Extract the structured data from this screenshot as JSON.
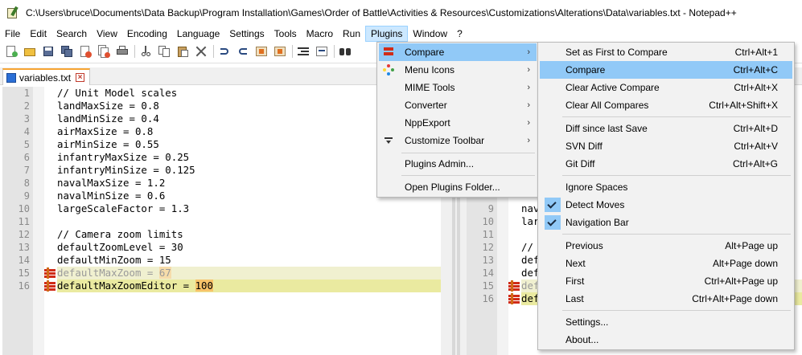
{
  "window": {
    "title": "C:\\Users\\bruce\\Documents\\Data Backup\\Program Installation\\Games\\Order of Battle\\Activities & Resources\\Customizations\\Alterations\\Data\\variables.txt - Notepad++"
  },
  "menubar": {
    "items": [
      "File",
      "Edit",
      "Search",
      "View",
      "Encoding",
      "Language",
      "Settings",
      "Tools",
      "Macro",
      "Run",
      "Plugins",
      "Window",
      "?"
    ]
  },
  "tab": {
    "label": "variables.txt"
  },
  "editor_left": {
    "lines": [
      {
        "n": "1",
        "text": "// Unit Model scales"
      },
      {
        "n": "2",
        "text": "landMaxSize = 0.8"
      },
      {
        "n": "3",
        "text": "landMinSize = 0.4"
      },
      {
        "n": "4",
        "text": "airMaxSize = 0.8"
      },
      {
        "n": "5",
        "text": "airMinSize = 0.55"
      },
      {
        "n": "6",
        "text": "infantryMaxSize = 0.25"
      },
      {
        "n": "7",
        "text": "infantryMinSize = 0.125"
      },
      {
        "n": "8",
        "text": "navalMaxSize = 1.2"
      },
      {
        "n": "9",
        "text": "navalMinSize = 0.6"
      },
      {
        "n": "10",
        "text": "largeScaleFactor = 1.3"
      },
      {
        "n": "11",
        "text": ""
      },
      {
        "n": "12",
        "text": "// Camera zoom limits"
      },
      {
        "n": "13",
        "text": "defaultZoomLevel = 30"
      },
      {
        "n": "14",
        "text": "defaultMinZoom = 15"
      },
      {
        "n": "15",
        "text": "defaultMaxZoom = ",
        "hl": "67"
      },
      {
        "n": "16",
        "text": "defaultMaxZoomEditor = ",
        "hl": "100"
      }
    ]
  },
  "editor_right": {
    "lines": [
      {
        "n": "9",
        "text": "nav"
      },
      {
        "n": "10",
        "text": "lar"
      },
      {
        "n": "11",
        "text": ""
      },
      {
        "n": "12",
        "text": "// "
      },
      {
        "n": "13",
        "text": "def"
      },
      {
        "n": "14",
        "text": "def"
      },
      {
        "n": "15",
        "text": "def"
      },
      {
        "n": "16",
        "text": "def"
      }
    ]
  },
  "plugins_menu": {
    "items": [
      {
        "label": "Compare",
        "submenu": true,
        "icon": "compare-icon"
      },
      {
        "label": "Menu Icons",
        "submenu": true,
        "icon": "menu-icons-icon"
      },
      {
        "label": "MIME Tools",
        "submenu": true
      },
      {
        "label": "Converter",
        "submenu": true
      },
      {
        "label": "NppExport",
        "submenu": true
      },
      {
        "label": "Customize Toolbar",
        "submenu": true,
        "icon": "customize-toolbar-icon"
      },
      {
        "label": "Plugins Admin..."
      },
      {
        "label": "Open Plugins Folder..."
      }
    ]
  },
  "compare_menu": {
    "items": [
      {
        "label": "Set as First to Compare",
        "shortcut": "Ctrl+Alt+1"
      },
      {
        "label": "Compare",
        "shortcut": "Ctrl+Alt+C"
      },
      {
        "label": "Clear Active Compare",
        "shortcut": "Ctrl+Alt+X"
      },
      {
        "label": "Clear All Compares",
        "shortcut": "Ctrl+Alt+Shift+X"
      },
      {
        "label": "Diff since last Save",
        "shortcut": "Ctrl+Alt+D"
      },
      {
        "label": "SVN Diff",
        "shortcut": "Ctrl+Alt+V"
      },
      {
        "label": "Git Diff",
        "shortcut": "Ctrl+Alt+G"
      },
      {
        "label": "Ignore Spaces",
        "shortcut": ""
      },
      {
        "label": "Detect Moves",
        "shortcut": "",
        "checked": true
      },
      {
        "label": "Navigation Bar",
        "shortcut": "",
        "checked": true
      },
      {
        "label": "Previous",
        "shortcut": "Alt+Page up"
      },
      {
        "label": "Next",
        "shortcut": "Alt+Page down"
      },
      {
        "label": "First",
        "shortcut": "Ctrl+Alt+Page up"
      },
      {
        "label": "Last",
        "shortcut": "Ctrl+Alt+Page down"
      },
      {
        "label": "Settings...",
        "shortcut": ""
      },
      {
        "label": "About...",
        "shortcut": ""
      }
    ]
  },
  "colors": {
    "menu_highlight": "#91c9f7",
    "changed_line": "#eaeaa0",
    "diff_highlight": "#f7c36a",
    "diff_marker": "#d02c18"
  }
}
